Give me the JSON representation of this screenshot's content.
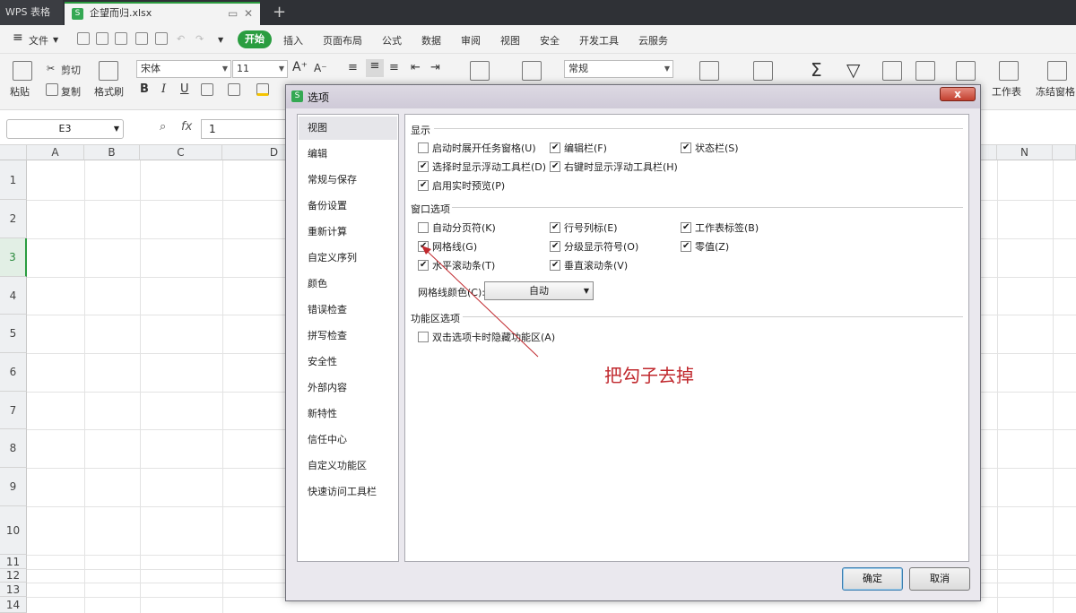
{
  "titlebar": {
    "app_tab": "WPS 表格",
    "file_tab": "企望而归.xlsx",
    "file_icon_letter": "S"
  },
  "menubar": {
    "file_label": "文件",
    "start_label": "开始",
    "tabs": [
      "插入",
      "页面布局",
      "公式",
      "数据",
      "审阅",
      "视图",
      "安全",
      "开发工具",
      "云服务"
    ]
  },
  "ribbon": {
    "paste": "粘贴",
    "cut": "剪切",
    "copy": "复制",
    "format_painter": "格式刷",
    "font": "宋体",
    "font_size": "11",
    "number_format": "常规",
    "worksheet": "工作表",
    "freeze": "冻结窗格",
    "bold": "B",
    "italic": "I",
    "underline": "U"
  },
  "formula_bar": {
    "cell_ref": "E3",
    "fx": "fx",
    "value": "1"
  },
  "grid": {
    "columns": [
      "A",
      "B",
      "C",
      "D",
      "N"
    ],
    "rows": [
      "1",
      "2",
      "3",
      "4",
      "5",
      "6",
      "7",
      "8",
      "9",
      "10",
      "11",
      "12",
      "13",
      "14"
    ],
    "selected_row": "3"
  },
  "dialog": {
    "title": "选项",
    "icon_letter": "S",
    "close": "x",
    "nav": [
      "视图",
      "编辑",
      "常规与保存",
      "备份设置",
      "重新计算",
      "自定义序列",
      "颜色",
      "错误检查",
      "拼写检查",
      "安全性",
      "外部内容",
      "新特性",
      "信任中心",
      "自定义功能区",
      "快速访问工具栏"
    ],
    "selected_nav": "视图",
    "sections": {
      "display": {
        "title": "显示",
        "options": [
          {
            "label": "启动时展开任务窗格(U)",
            "checked": false
          },
          {
            "label": "编辑栏(F)",
            "checked": true
          },
          {
            "label": "状态栏(S)",
            "checked": true
          },
          {
            "label": "选择时显示浮动工具栏(D)",
            "checked": true
          },
          {
            "label": "右键时显示浮动工具栏(H)",
            "checked": true
          },
          {
            "label": "启用实时预览(P)",
            "checked": true
          }
        ]
      },
      "window": {
        "title": "窗口选项",
        "options": [
          {
            "label": "自动分页符(K)",
            "checked": false
          },
          {
            "label": "行号列标(E)",
            "checked": true
          },
          {
            "label": "工作表标签(B)",
            "checked": true
          },
          {
            "label": "网格线(G)",
            "checked": true
          },
          {
            "label": "分级显示符号(O)",
            "checked": true
          },
          {
            "label": "零值(Z)",
            "checked": true
          },
          {
            "label": "水平滚动条(T)",
            "checked": true
          },
          {
            "label": "垂直滚动条(V)",
            "checked": true
          }
        ],
        "gridline_color_label": "网格线颜色(C):",
        "gridline_color_value": "自动"
      },
      "ribbon": {
        "title": "功能区选项",
        "options": [
          {
            "label": "双击选项卡时隐藏功能区(A)",
            "checked": false
          }
        ]
      }
    },
    "annotation": "把勾子去掉",
    "ok": "确定",
    "cancel": "取消",
    "annotation_color": "#c0282d"
  }
}
